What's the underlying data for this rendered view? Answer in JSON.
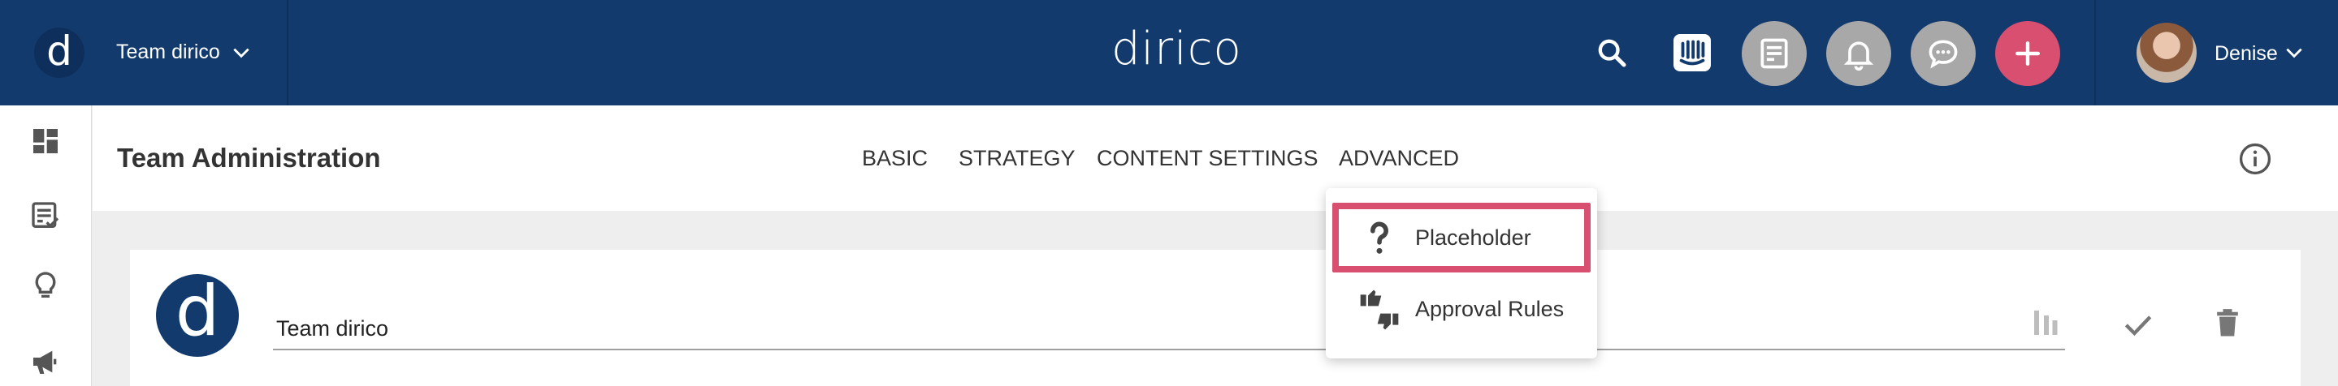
{
  "topbar": {
    "team_name": "Team dirico",
    "team_logo_letter": "d",
    "brand": "dirico",
    "user_name": "Denise",
    "icons": [
      "search-icon",
      "intercom-icon",
      "posts-icon",
      "bell-icon",
      "chat-icon",
      "add-icon",
      "chevron-down-icon"
    ],
    "colors": {
      "bar": "#123a6d",
      "add_button": "#d84f6f",
      "circle_button": "#a8a8a8"
    }
  },
  "leftrail": {
    "items": [
      "dashboard-icon",
      "posts-checklist-icon",
      "lightbulb-icon",
      "megaphone-icon"
    ]
  },
  "subheader": {
    "title": "Team Administration",
    "tabs": [
      {
        "label": "BASIC"
      },
      {
        "label": "STRATEGY"
      },
      {
        "label": "CONTENT SETTINGS"
      },
      {
        "label": "ADVANCED"
      }
    ]
  },
  "card": {
    "logo_letter": "d",
    "team_name_value": "Team dirico"
  },
  "dropdown": {
    "items": [
      {
        "label": "Placeholder",
        "icon": "question-mark-icon",
        "selected": true
      },
      {
        "label": "Approval Rules",
        "icon": "thumbs-up-down-icon",
        "selected": false
      }
    ],
    "highlight_color": "#d84f6f"
  }
}
